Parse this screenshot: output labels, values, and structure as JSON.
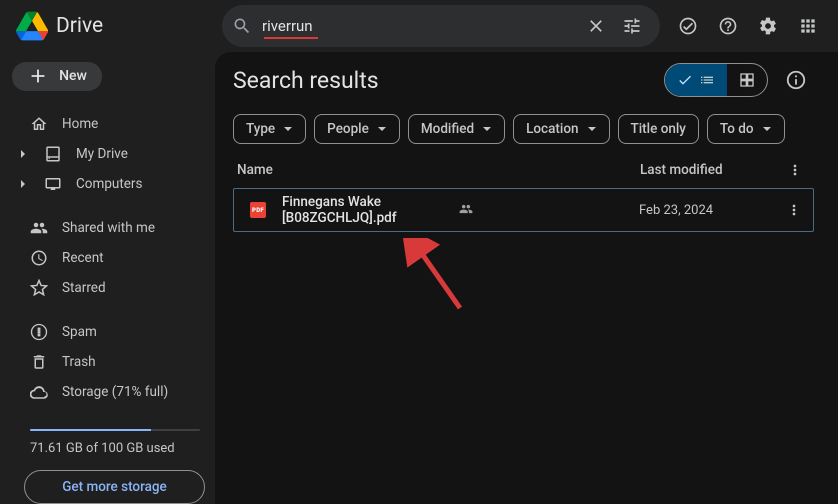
{
  "brand": "Drive",
  "search": {
    "value": "riverrun"
  },
  "header_icons": [
    "offline",
    "help",
    "settings",
    "apps"
  ],
  "sidebar": {
    "new_label": "New",
    "group1": [
      {
        "label": "Home",
        "icon": "home",
        "expandable": false
      },
      {
        "label": "My Drive",
        "icon": "drive",
        "expandable": true
      },
      {
        "label": "Computers",
        "icon": "computers",
        "expandable": true
      }
    ],
    "group2": [
      {
        "label": "Shared with me",
        "icon": "shared"
      },
      {
        "label": "Recent",
        "icon": "recent"
      },
      {
        "label": "Starred",
        "icon": "star"
      }
    ],
    "group3": [
      {
        "label": "Spam",
        "icon": "spam"
      },
      {
        "label": "Trash",
        "icon": "trash"
      },
      {
        "label": "Storage (71% full)",
        "icon": "cloud"
      }
    ],
    "storage_text": "71.61 GB of 100 GB used",
    "storage_percent": 71,
    "get_storage_label": "Get more storage"
  },
  "main": {
    "title": "Search results",
    "filters": [
      {
        "label": "Type",
        "caret": true
      },
      {
        "label": "People",
        "caret": true
      },
      {
        "label": "Modified",
        "caret": true
      },
      {
        "label": "Location",
        "caret": true
      },
      {
        "label": "Title only",
        "caret": false
      },
      {
        "label": "To do",
        "caret": true
      }
    ],
    "columns": {
      "name": "Name",
      "modified": "Last modified"
    },
    "rows": [
      {
        "name": "Finnegans Wake [B08ZGCHLJQ].pdf",
        "modified": "Feb 23, 2024",
        "type": "pdf",
        "shared": true
      }
    ]
  }
}
